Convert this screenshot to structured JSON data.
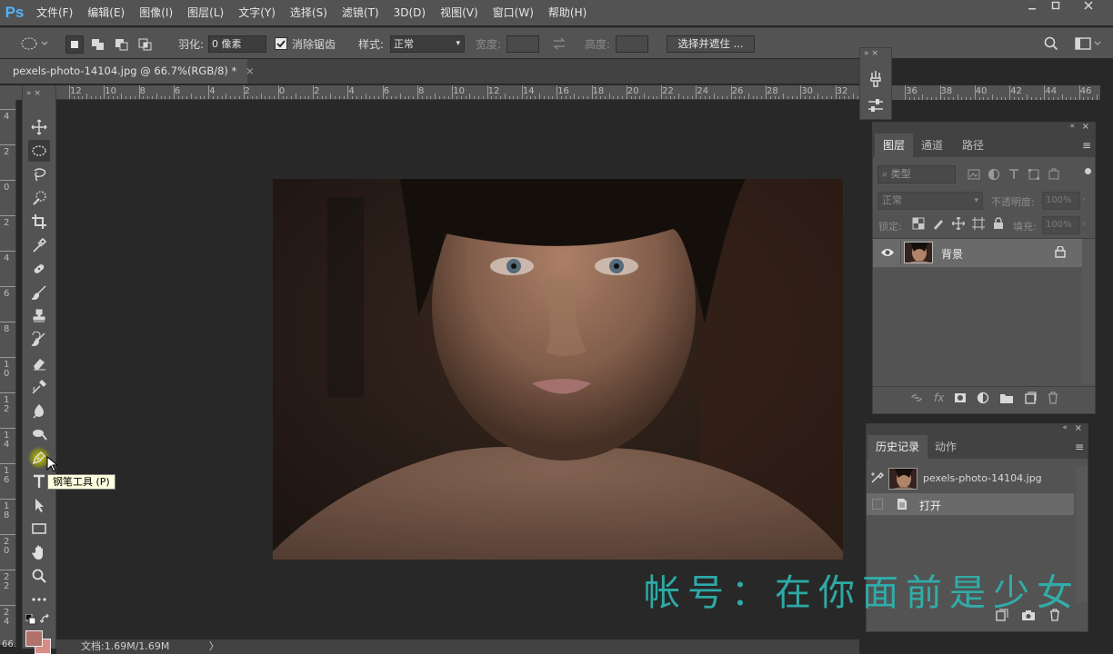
{
  "app": {
    "logo": "Ps"
  },
  "menu": [
    "文件(F)",
    "编辑(E)",
    "图像(I)",
    "图层(L)",
    "文字(Y)",
    "选择(S)",
    "滤镜(T)",
    "3D(D)",
    "视图(V)",
    "窗口(W)",
    "帮助(H)"
  ],
  "window_controls": [
    "minimize-icon",
    "restore-icon",
    "close-icon"
  ],
  "options": {
    "feather_label": "羽化:",
    "feather_value": "0 像素",
    "antialias_label": "消除锯齿",
    "antialias_checked": true,
    "style_label": "样式:",
    "style_value": "正常",
    "width_label": "宽度:",
    "height_label": "高度:",
    "select_mask_button": "选择并遮住 ..."
  },
  "document": {
    "tab_title": "pexels-photo-14104.jpg @ 66.7%(RGB/8) *",
    "close": "×"
  },
  "ruler": {
    "top_numbers": [
      "12",
      "10",
      "8",
      "6",
      "4",
      "2",
      "0",
      "2",
      "4",
      "6",
      "8",
      "10",
      "12",
      "14",
      "16",
      "18",
      "20",
      "22",
      "24",
      "26",
      "28",
      "30",
      "32",
      "34",
      "36",
      "38",
      "40",
      "42",
      "44",
      "46"
    ],
    "left_numbers": [
      "4",
      "2",
      "0",
      "2",
      "4",
      "6",
      "8",
      "10",
      "12",
      "14",
      "16",
      "18",
      "20",
      "22",
      "24"
    ]
  },
  "tools": [
    "move-tool-icon",
    "elliptical-marquee-icon",
    "lasso-icon",
    "quick-selection-icon",
    "crop-icon",
    "eyedropper-icon",
    "healing-brush-icon",
    "brush-icon",
    "clone-stamp-icon",
    "history-brush-icon",
    "eraser-icon",
    "gradient-icon",
    "blur-icon",
    "dodge-icon",
    "pen-icon",
    "type-icon",
    "path-selection-icon",
    "rectangle-icon",
    "hand-icon",
    "zoom-icon",
    "more-tools-icon"
  ],
  "tooltip": "钢笔工具 (P)",
  "zoom_label": "66.",
  "status": {
    "doc_size": "文档:1.69M/1.69M",
    "arrow": "〉"
  },
  "colors": {
    "foreground": "#b0726b",
    "background": "#d98b86",
    "accent": "#4fb4ff",
    "watermark": "#2fb4b0"
  },
  "layers_panel": {
    "tabs": [
      "图层",
      "通道",
      "路径"
    ],
    "active_tab": "图层",
    "filter_placeholder": "类型",
    "blend_mode": "正常",
    "opacity_label": "不透明度:",
    "opacity_value": "100%",
    "lock_label": "锁定:",
    "fill_label": "填充:",
    "fill_value": "100%",
    "layers": [
      {
        "name": "背景",
        "locked": true,
        "visible": true
      }
    ]
  },
  "history_panel": {
    "tabs": [
      "历史记录",
      "动作"
    ],
    "active_tab": "历史记录",
    "snapshot": "pexels-photo-14104.jpg",
    "items": [
      "打开"
    ]
  },
  "watermark": "帐号：在你面前是少女"
}
